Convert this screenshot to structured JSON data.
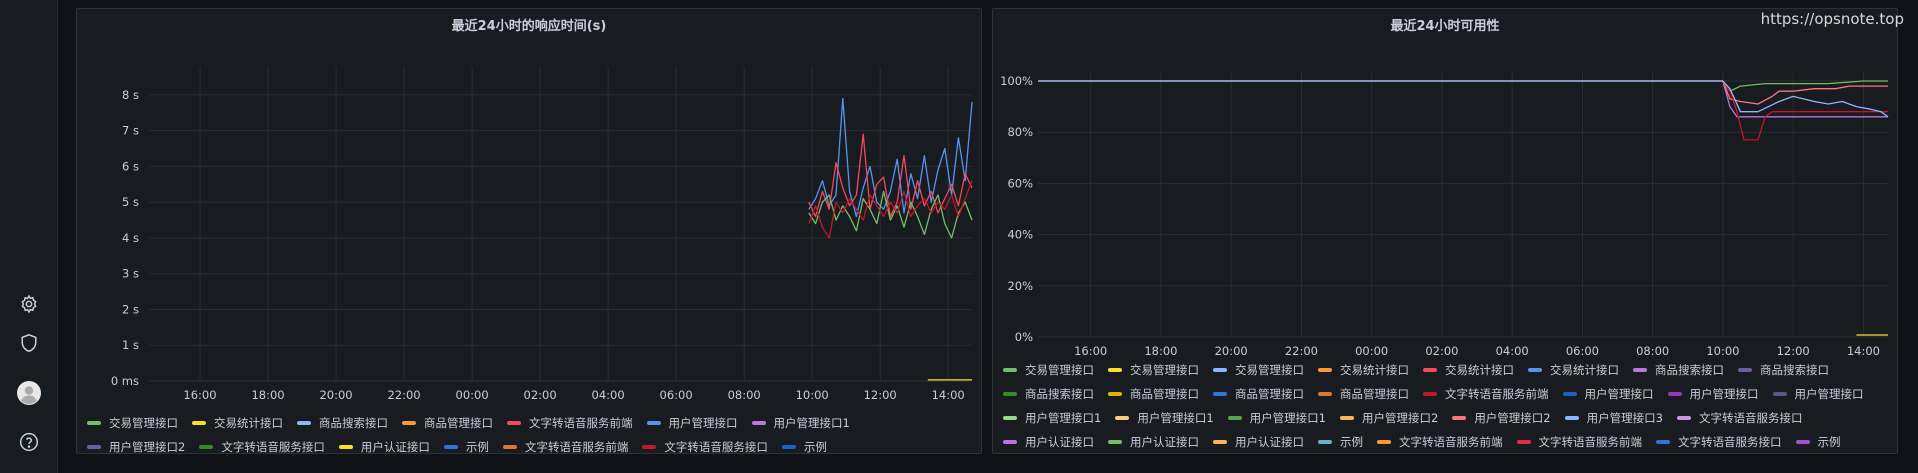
{
  "watermark": "https://opsnote.top",
  "sidebar": {
    "icons": [
      "gear-icon",
      "shield-icon",
      "avatar",
      "help-icon"
    ]
  },
  "chart_data": [
    {
      "type": "line",
      "title": "最近24小时的响应时间(s)",
      "xlabel": "",
      "ylabel": "",
      "x_ticks": [
        "16:00",
        "18:00",
        "20:00",
        "22:00",
        "00:00",
        "02:00",
        "04:00",
        "06:00",
        "08:00",
        "10:00",
        "12:00",
        "14:00"
      ],
      "y_ticks": [
        "0 ms",
        "1 s",
        "2 s",
        "3 s",
        "4 s",
        "5 s",
        "6 s",
        "7 s",
        "8 s"
      ],
      "ylim": [
        0,
        8.5
      ],
      "xlim_hours": [
        14.5,
        38.7
      ],
      "grid": true,
      "legend_placement": "bottom",
      "legend": [
        {
          "name": "交易管理接口",
          "color": "#73bf69"
        },
        {
          "name": "交易统计接口",
          "color": "#fade2a"
        },
        {
          "name": "商品搜索接口",
          "color": "#8ab8ff"
        },
        {
          "name": "商品管理接口",
          "color": "#ff9830"
        },
        {
          "name": "文字转语音服务前端",
          "color": "#f2495c"
        },
        {
          "name": "用户管理接口",
          "color": "#5794f2"
        },
        {
          "name": "用户管理接口1",
          "color": "#b877d9"
        },
        {
          "name": "用户管理接口2",
          "color": "#705da0"
        },
        {
          "name": "文字转语音服务接口",
          "color": "#37872d"
        },
        {
          "name": "用户认证接口",
          "color": "#fade2a"
        },
        {
          "name": "示例",
          "color": "#3274d9"
        },
        {
          "name": "文字转语音服务前端",
          "color": "#e0752d"
        },
        {
          "name": "文字转语音服务接口",
          "color": "#c4162a"
        },
        {
          "name": "示例",
          "color": "#1f60c4"
        }
      ],
      "series": [
        {
          "name": "用户管理接口",
          "color": "#5794f2",
          "x": [
            33.9,
            34.1,
            34.3,
            34.5,
            34.7,
            34.9,
            35.1,
            35.3,
            35.5,
            35.7,
            35.9,
            36.1,
            36.3,
            36.5,
            36.7,
            36.9,
            37.1,
            37.3,
            37.5,
            37.7,
            37.9,
            38.1,
            38.3,
            38.5,
            38.7
          ],
          "y": [
            4.8,
            5.1,
            5.6,
            4.9,
            5.2,
            7.9,
            5.3,
            4.6,
            5.4,
            6.0,
            5.0,
            4.8,
            5.3,
            6.2,
            4.7,
            5.8,
            5.1,
            6.3,
            5.0,
            5.9,
            6.5,
            5.2,
            6.8,
            5.6,
            7.8
          ]
        },
        {
          "name": "文字转语音服务前端",
          "color": "#f2495c",
          "x": [
            33.9,
            34.1,
            34.3,
            34.5,
            34.7,
            34.9,
            35.1,
            35.3,
            35.5,
            35.7,
            35.9,
            36.1,
            36.3,
            36.5,
            36.7,
            36.9,
            37.1,
            37.3,
            37.5,
            37.7,
            37.9,
            38.1,
            38.3,
            38.5,
            38.7
          ],
          "y": [
            5.0,
            4.6,
            5.3,
            4.8,
            6.1,
            5.4,
            4.9,
            5.2,
            6.9,
            4.8,
            5.5,
            5.7,
            4.6,
            5.0,
            6.3,
            4.8,
            5.6,
            4.9,
            5.3,
            4.7,
            5.1,
            5.5,
            4.9,
            5.8,
            5.4
          ]
        },
        {
          "name": "交易管理接口",
          "color": "#73bf69",
          "x": [
            33.9,
            34.1,
            34.3,
            34.5,
            34.7,
            34.9,
            35.1,
            35.3,
            35.5,
            35.7,
            35.9,
            36.1,
            36.3,
            36.5,
            36.7,
            36.9,
            37.1,
            37.3,
            37.5,
            37.7,
            37.9,
            38.1,
            38.3,
            38.5,
            38.7
          ],
          "y": [
            4.7,
            4.4,
            5.0,
            5.2,
            4.5,
            4.9,
            4.6,
            4.2,
            5.1,
            4.8,
            4.4,
            5.3,
            4.5,
            4.9,
            4.3,
            5.0,
            4.6,
            4.1,
            4.8,
            5.2,
            4.4,
            4.0,
            4.7,
            5.0,
            4.5
          ]
        },
        {
          "name": "文字转语音服务接口",
          "color": "#c4162a",
          "x": [
            33.9,
            34.1,
            34.3,
            34.5,
            34.7,
            34.9,
            35.1,
            35.3,
            35.5,
            35.7,
            35.9,
            36.1,
            36.3,
            36.5,
            36.7,
            36.9,
            37.1,
            37.3,
            37.5,
            37.7,
            37.9,
            38.1,
            38.3,
            38.5,
            38.7
          ],
          "y": [
            4.4,
            4.9,
            4.3,
            4.0,
            5.0,
            4.7,
            5.1,
            4.8,
            4.5,
            5.2,
            4.9,
            4.6,
            5.0,
            4.7,
            5.3,
            4.6,
            4.9,
            5.1,
            4.7,
            5.0,
            4.8,
            5.2,
            4.6,
            5.1,
            5.6
          ]
        },
        {
          "name": "用户认证接口",
          "color": "#fade2a",
          "x": [
            37.4,
            38.7
          ],
          "y": [
            0.03,
            0.03
          ]
        }
      ]
    },
    {
      "type": "line",
      "title": "最近24小时可用性",
      "xlabel": "",
      "ylabel": "",
      "x_ticks": [
        "16:00",
        "18:00",
        "20:00",
        "22:00",
        "00:00",
        "02:00",
        "04:00",
        "06:00",
        "08:00",
        "10:00",
        "12:00",
        "14:00"
      ],
      "y_ticks": [
        "0%",
        "20%",
        "40%",
        "60%",
        "80%",
        "100%"
      ],
      "ylim": [
        0,
        100
      ],
      "xlim_hours": [
        14.5,
        38.7
      ],
      "grid": true,
      "legend_placement": "bottom",
      "legend": [
        {
          "name": "交易管理接口",
          "color": "#73bf69"
        },
        {
          "name": "交易管理接口",
          "color": "#fade2a"
        },
        {
          "name": "交易管理接口",
          "color": "#8ab8ff"
        },
        {
          "name": "交易统计接口",
          "color": "#ff9830"
        },
        {
          "name": "交易统计接口",
          "color": "#f2495c"
        },
        {
          "name": "交易统计接口",
          "color": "#5794f2"
        },
        {
          "name": "商品搜索接口",
          "color": "#b877d9"
        },
        {
          "name": "商品搜索接口",
          "color": "#705da0"
        },
        {
          "name": "商品搜索接口",
          "color": "#37872d"
        },
        {
          "name": "商品管理接口",
          "color": "#e0b400"
        },
        {
          "name": "商品管理接口",
          "color": "#3274d9"
        },
        {
          "name": "商品管理接口",
          "color": "#e0752d"
        },
        {
          "name": "文字转语音服务前端",
          "color": "#c4162a"
        },
        {
          "name": "用户管理接口",
          "color": "#1f60c4"
        },
        {
          "name": "用户管理接口",
          "color": "#8f3bb8"
        },
        {
          "name": "用户管理接口",
          "color": "#5a5a8a"
        },
        {
          "name": "用户管理接口1",
          "color": "#96d98d"
        },
        {
          "name": "用户管理接口1",
          "color": "#ffcb7d"
        },
        {
          "name": "用户管理接口1",
          "color": "#56a64b"
        },
        {
          "name": "用户管理接口2",
          "color": "#ffb357"
        },
        {
          "name": "用户管理接口2",
          "color": "#ff7383"
        },
        {
          "name": "用户管理接口3",
          "color": "#8ab8ff"
        },
        {
          "name": "文字转语音服务接口",
          "color": "#ca95e5"
        },
        {
          "name": "用户认证接口",
          "color": "#b877d9"
        },
        {
          "name": "用户认证接口",
          "color": "#73bf69"
        },
        {
          "name": "用户认证接口",
          "color": "#ffb357"
        },
        {
          "name": "示例",
          "color": "#6ab0c2"
        },
        {
          "name": "文字转语音服务前端",
          "color": "#ff9830"
        },
        {
          "name": "文字转语音服务前端",
          "color": "#e02f44"
        },
        {
          "name": "文字转语音服务接口",
          "color": "#3274d9"
        },
        {
          "name": "示例",
          "color": "#a352cc"
        }
      ],
      "series": [
        {
          "name": "交易管理接口",
          "color": "#b877d9",
          "x": [
            14.5,
            33.8,
            34.0,
            34.2,
            34.4,
            35.0,
            38.7
          ],
          "y": [
            100,
            100,
            100,
            90,
            86,
            86,
            86
          ]
        },
        {
          "name": "交易统计接口",
          "color": "#ff7383",
          "x": [
            14.5,
            34.0,
            34.2,
            34.5,
            35.0,
            35.4,
            35.6,
            36.0,
            36.6,
            37.2,
            37.6,
            38.2,
            38.7
          ],
          "y": [
            100,
            100,
            93,
            92,
            91,
            94,
            96,
            96,
            97,
            97,
            98,
            98,
            98
          ]
        },
        {
          "name": "交易管理接口",
          "color": "#73bf69",
          "x": [
            14.5,
            34.0,
            34.2,
            34.5,
            35.2,
            36.0,
            37.0,
            38.0,
            38.7
          ],
          "y": [
            100,
            100,
            96,
            98,
            99,
            99,
            99,
            100,
            100
          ]
        },
        {
          "name": "文字转语音服务前端",
          "color": "#c4162a",
          "x": [
            14.5,
            34.0,
            34.2,
            34.4,
            34.6,
            35.0,
            35.2,
            35.4,
            36.0,
            38.7
          ],
          "y": [
            100,
            100,
            96,
            88,
            77,
            77,
            86,
            88,
            88,
            88
          ]
        },
        {
          "name": "商品搜索接口",
          "color": "#8ab8ff",
          "x": [
            14.5,
            34.0,
            34.2,
            34.5,
            35.0,
            35.6,
            36.0,
            36.6,
            37.0,
            37.4,
            37.8,
            38.2,
            38.5,
            38.7
          ],
          "y": [
            100,
            100,
            97,
            88,
            88,
            92,
            94,
            92,
            91,
            92,
            90,
            89,
            88,
            86
          ]
        },
        {
          "name": "用户认证接口",
          "color": "#fade2a",
          "x": [
            37.8,
            38.7
          ],
          "y": [
            0.8,
            0.8
          ]
        }
      ]
    }
  ]
}
